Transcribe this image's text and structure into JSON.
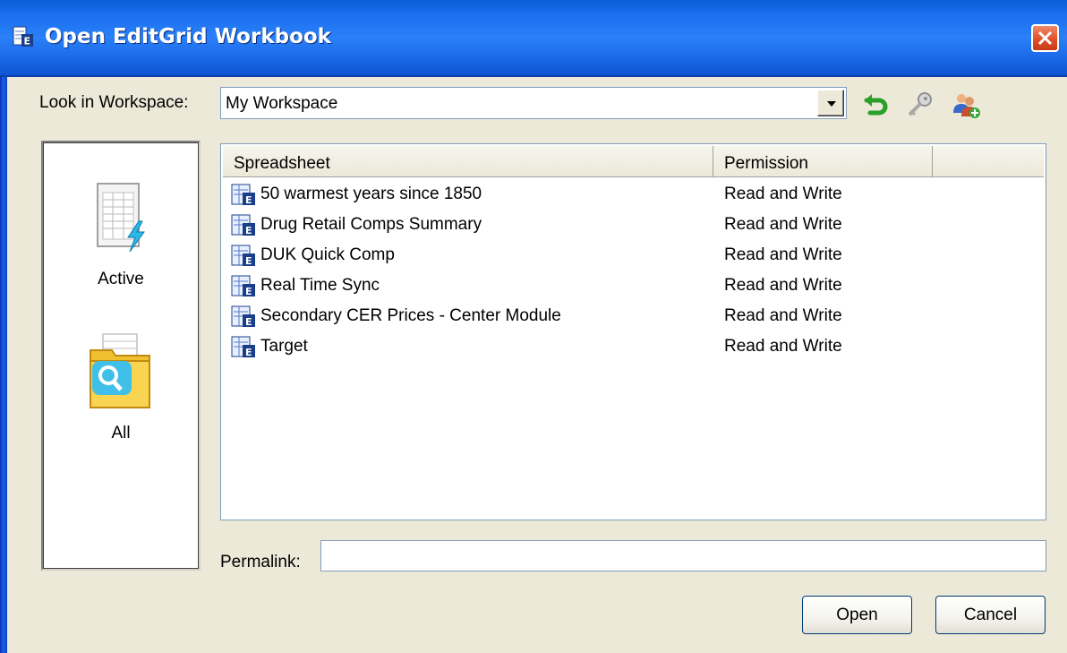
{
  "window": {
    "title": "Open EditGrid Workbook",
    "close_icon": "close-icon"
  },
  "lookin": {
    "label": "Look in Workspace:",
    "value": "My Workspace",
    "tools": [
      "refresh-icon",
      "key-icon",
      "users-icon"
    ]
  },
  "places": [
    {
      "label": "Active",
      "icon": "active-workbook-icon"
    },
    {
      "label": "All",
      "icon": "folder-search-icon"
    }
  ],
  "list": {
    "columns": [
      "Spreadsheet",
      "Permission",
      ""
    ],
    "rows": [
      {
        "name": "50 warmest years since 1850",
        "permission": "Read and Write"
      },
      {
        "name": "Drug Retail Comps Summary",
        "permission": "Read and Write"
      },
      {
        "name": "DUK Quick Comp",
        "permission": "Read and Write"
      },
      {
        "name": "Real Time Sync",
        "permission": "Read and Write"
      },
      {
        "name": "Secondary CER Prices - Center Module",
        "permission": "Read and Write"
      },
      {
        "name": "Target",
        "permission": "Read and Write"
      }
    ]
  },
  "permalink": {
    "label": "Permalink:",
    "value": ""
  },
  "buttons": {
    "open": "Open",
    "cancel": "Cancel"
  }
}
